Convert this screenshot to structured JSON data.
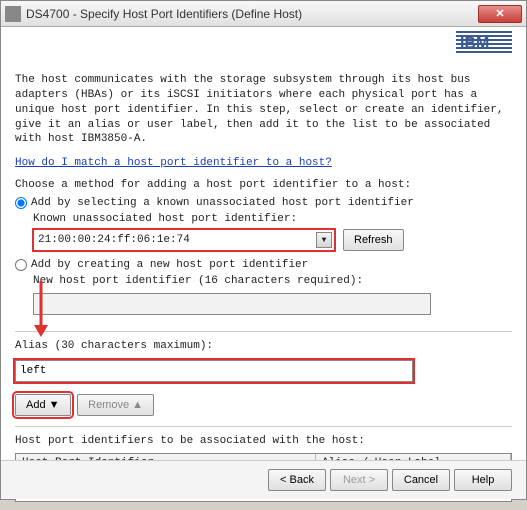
{
  "window": {
    "title": "DS4700 - Specify Host Port Identifiers (Define Host)"
  },
  "logo_text": "IBM",
  "intro_text": "The host communicates with the storage subsystem through its host bus adapters (HBAs) or its iSCSI initiators where each physical port has a unique host port identifier. In this step, select or create an identifier, give it an alias or user label, then add it to the list to be associated with host IBM3850-A.",
  "help_link": "How do I match a host port identifier to a host?",
  "method_label": "Choose a method for adding a host port identifier to a host:",
  "radio1_label": "Add by selecting a known unassociated host port identifier",
  "known_label": "Known unassociated host port identifier:",
  "dropdown_value": "21:00:00:24:ff:06:1e:74",
  "refresh_label": "Refresh",
  "radio2_label": "Add by creating a new host port identifier",
  "newhost_label": "New host port identifier (16 characters required):",
  "newhost_value": "",
  "alias_label": "Alias (30 characters maximum):",
  "alias_value": "left",
  "add_label": "Add ▼",
  "remove_label": "Remove ▲",
  "table_label": "Host port identifiers to be associated with the host:",
  "table_headers": {
    "col1": "Host Port Identifier",
    "col2": "Alias / User Label"
  },
  "footer": {
    "back": "< Back",
    "next": "Next >",
    "cancel": "Cancel",
    "help": "Help"
  }
}
